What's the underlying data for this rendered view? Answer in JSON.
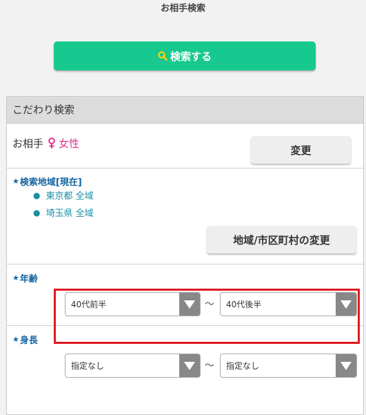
{
  "header": {
    "title": "お相手検索"
  },
  "search_button": {
    "label": "検索する"
  },
  "panel": {
    "title": "こだわり検索",
    "partner": {
      "label": "お相手",
      "gender_symbol": "♀",
      "gender": "女性",
      "change_label": "変更"
    },
    "area": {
      "title": "検索地域[現在]",
      "items": [
        {
          "label": "東京都 全域"
        },
        {
          "label": "埼玉県 全域"
        }
      ],
      "change_label": "地域/市区町村の変更"
    },
    "age": {
      "title": "年齢",
      "from": "40代前半",
      "to": "40代後半",
      "separator": "～"
    },
    "height": {
      "title": "身長",
      "from": "指定なし",
      "to": "指定なし",
      "separator": "～"
    }
  },
  "colors": {
    "accent": "#17c98f",
    "highlight": "#e0191f",
    "female": "#e2338f",
    "section_title": "#1565a0"
  },
  "icons": {
    "search": "search-icon",
    "female": "female-icon",
    "star": "star-icon",
    "dropdown": "chevron-down-icon"
  }
}
